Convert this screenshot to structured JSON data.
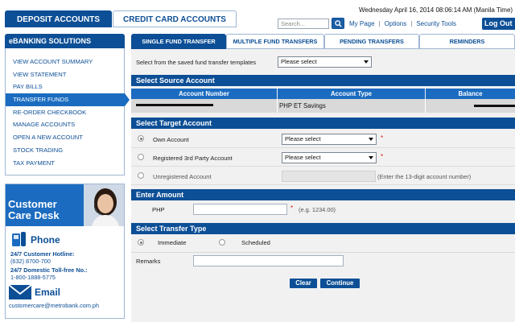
{
  "top_tabs": [
    {
      "label": "DEPOSIT ACCOUNTS"
    },
    {
      "label": "CREDIT CARD ACCOUNTS"
    }
  ],
  "header": {
    "datetime": "Wednesday April 16, 2014 08:06:14 AM (Manila Time)",
    "search_placeholder": "Search...",
    "links": [
      "My Page",
      "Options",
      "Security Tools"
    ],
    "logout": "Log Out"
  },
  "sidebar": {
    "title": "eBANKING SOLUTIONS",
    "items": [
      {
        "label": "VIEW ACCOUNT SUMMARY"
      },
      {
        "label": "VIEW STATEMENT"
      },
      {
        "label": "PAY BILLS"
      },
      {
        "label": "TRANSFER FUNDS"
      },
      {
        "label": "RE-ORDER CHECKBOOK"
      },
      {
        "label": "MANAGE ACCOUNTS"
      },
      {
        "label": "OPEN A NEW ACCOUNT"
      },
      {
        "label": "STOCK TRADING"
      },
      {
        "label": "TAX PAYMENT"
      }
    ]
  },
  "care": {
    "title_line1": "Customer",
    "title_line2": "Care Desk",
    "phone_label": "Phone",
    "hotline_label": "24/7 Customer Hotline:",
    "hotline_number": "(632) 8700-700",
    "tollfree_label": "24/7 Domestic Toll-free No.:",
    "tollfree_number": "1-800-1888-5775",
    "email_label": "Email",
    "email_address": "customercare@metrobank.com.ph"
  },
  "sub_tabs": [
    {
      "label": "SINGLE FUND TRANSFER"
    },
    {
      "label": "MULTIPLE FUND TRANSFERS"
    },
    {
      "label": "PENDING TRANSFERS"
    },
    {
      "label": "REMINDERS"
    }
  ],
  "template": {
    "prompt": "Select from the saved fund transfer templates",
    "selected": "Please select"
  },
  "source": {
    "title": "Select Source Account",
    "columns": [
      "Account Number",
      "Account Type",
      "Balance"
    ],
    "row": {
      "account_number": "",
      "account_type": "PHP ET Savings",
      "balance": ""
    }
  },
  "target": {
    "title": "Select Target Account",
    "own_label": "Own Account",
    "own_selected": "Please select",
    "registered_label": "Registered 3rd Party Account",
    "registered_selected": "Please select",
    "unregistered_label": "Unregistered Account",
    "unregistered_hint": "(Enter the 13-digit account number)",
    "required_mark": "*"
  },
  "amount": {
    "title": "Enter Amount",
    "currency": "PHP",
    "value": "",
    "hint": "(e.g. 1234.00)"
  },
  "transfer_type": {
    "title": "Select Transfer Type",
    "immediate": "Immediate",
    "scheduled": "Scheduled"
  },
  "remarks": {
    "label": "Remarks",
    "value": ""
  },
  "actions": {
    "clear": "Clear",
    "continue": "Continue"
  },
  "colors": {
    "primary": "#0d4f96",
    "accent": "#1b6cc0",
    "required": "#dd1111"
  }
}
